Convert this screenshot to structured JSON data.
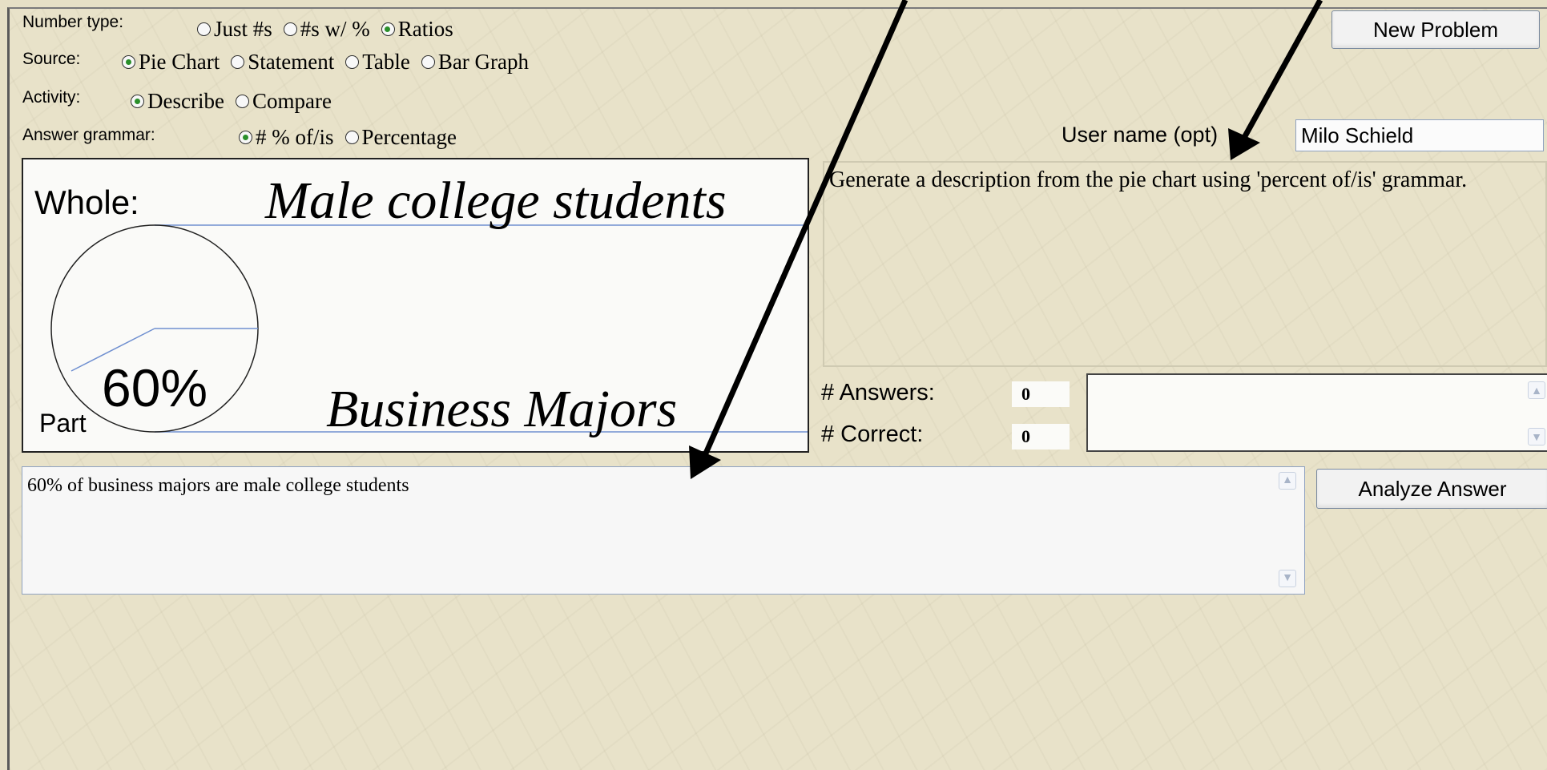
{
  "controls": {
    "number_type": {
      "label": "Number type:",
      "options": [
        {
          "label": "Just #s",
          "selected": false
        },
        {
          "label": "#s w/ %",
          "selected": false
        },
        {
          "label": "Ratios",
          "selected": true
        }
      ]
    },
    "source": {
      "label": "Source:",
      "options": [
        {
          "label": "Pie Chart",
          "selected": true
        },
        {
          "label": "Statement",
          "selected": false
        },
        {
          "label": "Table",
          "selected": false
        },
        {
          "label": "Bar Graph",
          "selected": false
        }
      ]
    },
    "activity": {
      "label": "Activity:",
      "options": [
        {
          "label": "Describe",
          "selected": true
        },
        {
          "label": "Compare",
          "selected": false
        }
      ]
    },
    "answer_grammar": {
      "label": "Answer grammar:",
      "options": [
        {
          "label": "# % of/is",
          "selected": true
        },
        {
          "label": "Percentage",
          "selected": false
        }
      ]
    }
  },
  "buttons": {
    "new_problem": "New Problem",
    "analyze_answer": "Analyze Answer"
  },
  "user": {
    "label": "User name (opt)",
    "value": "Milo Schield"
  },
  "pie": {
    "whole_label": "Whole:",
    "whole_value": "Male college students",
    "part_label": "Part",
    "part_value": "Business Majors",
    "percent_text": "60%",
    "percent": 60,
    "line_color": "#6f8fd0"
  },
  "prompt": "Generate a description from the pie chart using 'percent of/is' grammar.",
  "stats": {
    "answers_label": "# Answers:",
    "answers_value": "0",
    "correct_label": "# Correct:",
    "correct_value": "0"
  },
  "answer_text": "60% of business majors are male college students",
  "colors": {
    "background": "#e8e2c9",
    "radio_selected": "#2a8f2a",
    "input_border": "#8fa2c0"
  }
}
